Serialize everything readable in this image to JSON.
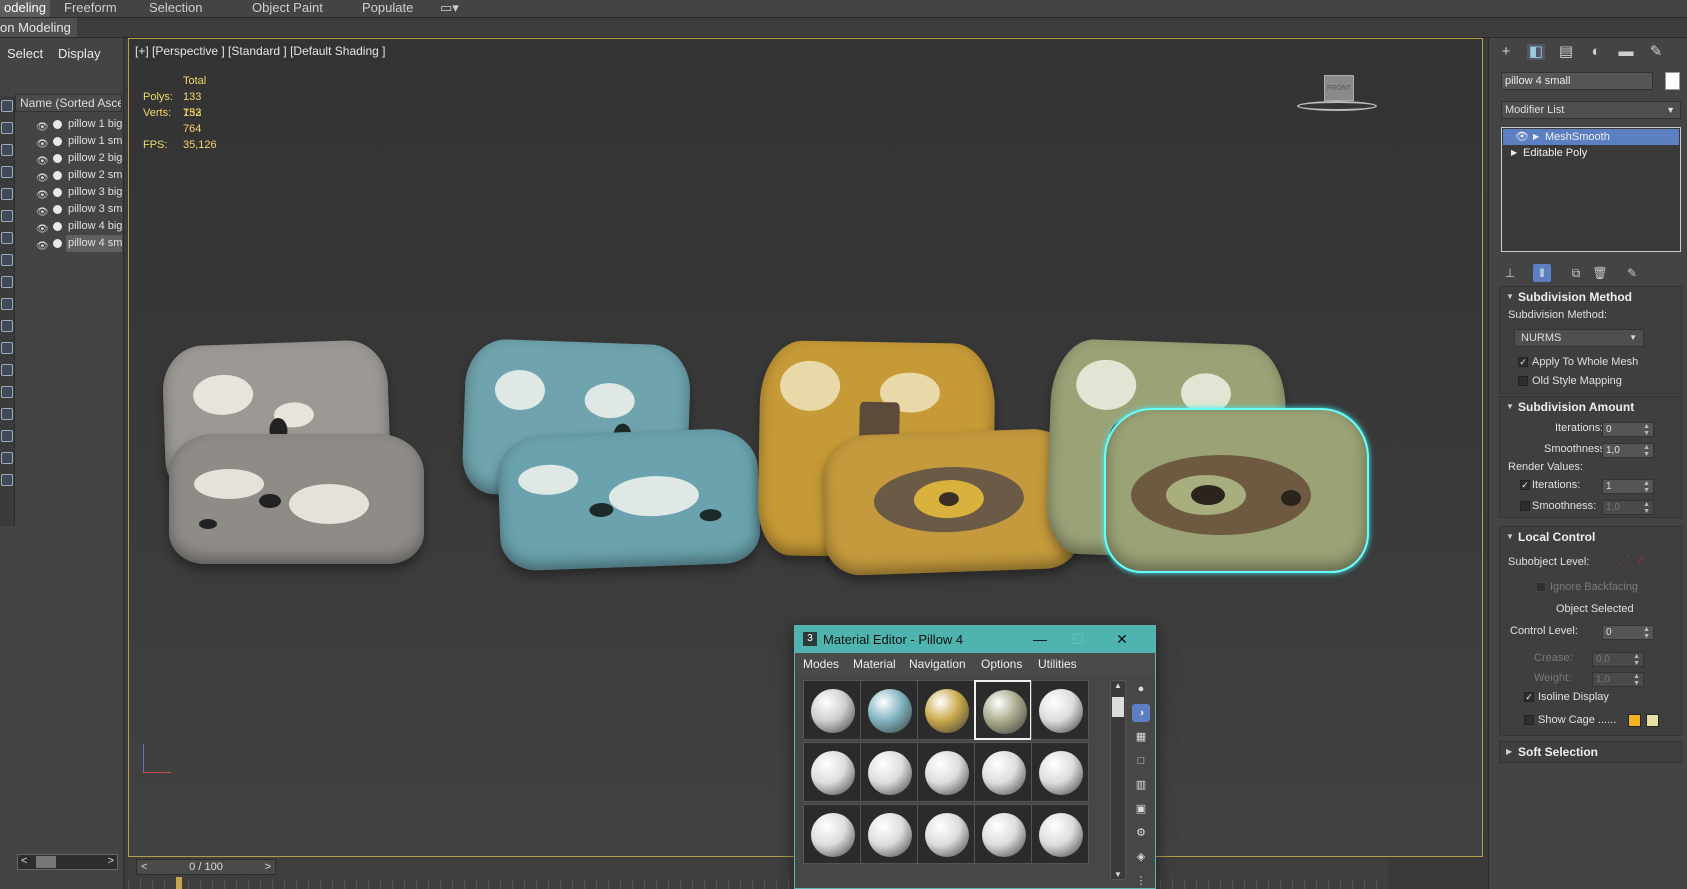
{
  "ribbon": {
    "tabs": [
      "odeling",
      "Freeform",
      "Selection",
      "Object Paint",
      "Populate"
    ],
    "active_tab": "odeling",
    "sub_label": "on Modeling"
  },
  "explorer": {
    "menu": {
      "select": "Select",
      "display": "Display"
    },
    "column_header": "Name (Sorted Ascen",
    "items": [
      {
        "name": "pillow 1 big"
      },
      {
        "name": "pillow 1 sm"
      },
      {
        "name": "pillow 2 big"
      },
      {
        "name": "pillow 2 sm"
      },
      {
        "name": "pillow 3 big"
      },
      {
        "name": "pillow 3 sm"
      },
      {
        "name": "pillow 4 big"
      },
      {
        "name": "pillow 4 sm"
      }
    ],
    "selected_index": 7,
    "scroll_left": "<",
    "scroll_right": ">"
  },
  "viewport": {
    "label": "[+] [Perspective ] [Standard ] [Default Shading ]",
    "stats": {
      "total_label": "Total",
      "polys_label": "Polys:",
      "polys": "133 752",
      "verts_label": "Verts:",
      "verts": "133 764",
      "fps_label": "FPS:",
      "fps": "35,126"
    },
    "viewcube_label": "FRONT",
    "accent_border": "#b5a048"
  },
  "timeline": {
    "frame": "0 / 100",
    "prev": "<",
    "next": ">"
  },
  "command_panel": {
    "object_name": "pillow 4 small",
    "object_color": "#ffffff",
    "modifier_list_label": "Modifier List",
    "stack": [
      {
        "name": "MeshSmooth",
        "selected": true
      },
      {
        "name": "Editable Poly",
        "selected": false
      }
    ],
    "subdivision_method": {
      "title": "Subdivision Method",
      "method_label": "Subdivision Method:",
      "method_value": "NURMS",
      "apply_whole_mesh": "Apply To Whole Mesh",
      "old_style_mapping": "Old Style Mapping"
    },
    "subdivision_amount": {
      "title": "Subdivision Amount",
      "iterations_label": "Iterations:",
      "iterations": "0",
      "smoothness_label": "Smoothness:",
      "smoothness": "1,0",
      "render_values_label": "Render Values:",
      "render_iterations_label": "Iterations:",
      "render_iterations": "1",
      "render_smoothness_label": "Smoothness:",
      "render_smoothness": "1,0"
    },
    "local_control": {
      "title": "Local Control",
      "subobject_label": "Subobject Level:",
      "ignore_backfacing": "Ignore Backfacing",
      "object_selected": "Object Selected",
      "control_level_label": "Control Level:",
      "control_level": "0",
      "crease_label": "Crease:",
      "crease": "0,0",
      "weight_label": "Weight:",
      "weight": "1,0",
      "isoline_display": "Isoline Display",
      "show_cage": "Show Cage ......",
      "cage_color_1": "#f2b321",
      "cage_color_2": "#e8e0a0"
    },
    "soft_selection": {
      "title": "Soft Selection"
    }
  },
  "material_editor": {
    "badge": "3",
    "title": "Material Editor - Pillow 4",
    "minimize": "—",
    "maximize": "☐",
    "close": "✕",
    "menu": [
      "Modes",
      "Material",
      "Navigation",
      "Options",
      "Utilities"
    ],
    "slot_colors": [
      "#cfcfcf",
      "#7fb3bf",
      "#c9a84a",
      "#a9a98a",
      "#dddddd",
      "#dddddd",
      "#dddddd",
      "#dddddd",
      "#dddddd",
      "#dddddd",
      "#dddddd",
      "#dddddd",
      "#dddddd",
      "#dddddd",
      "#dddddd"
    ],
    "selected_slot": 3
  }
}
